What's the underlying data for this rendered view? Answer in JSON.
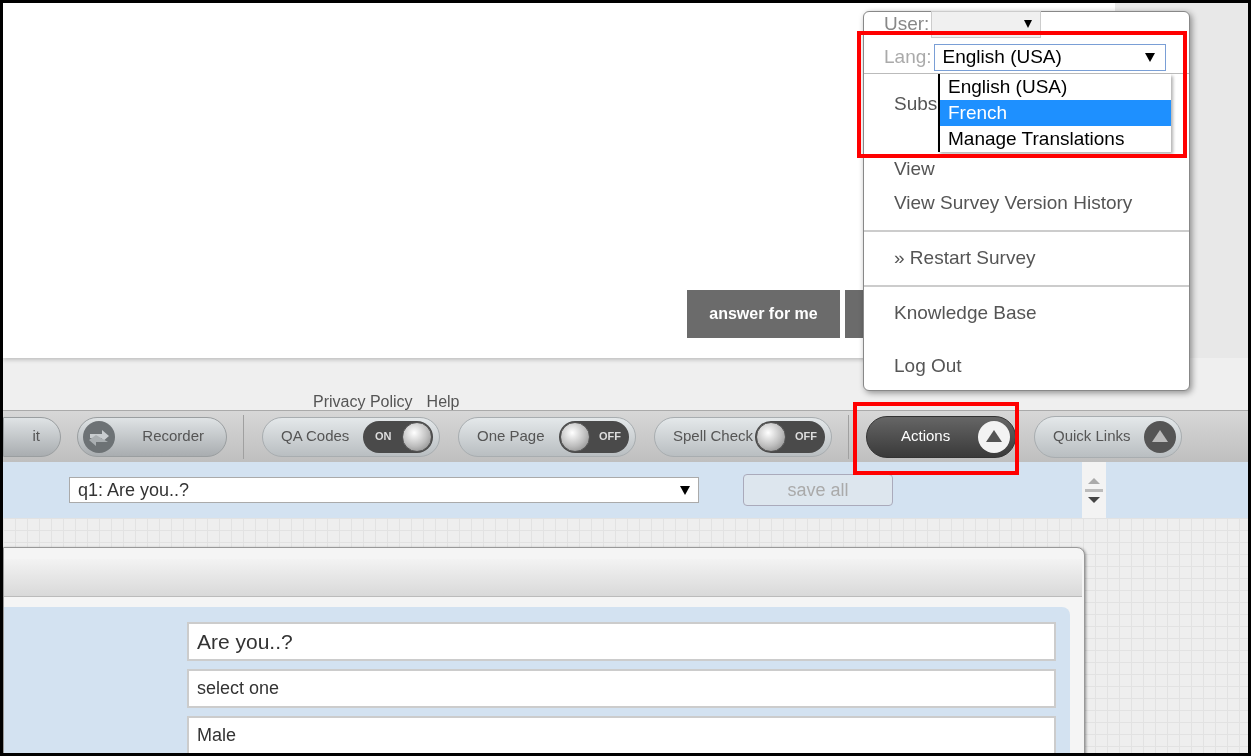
{
  "preview": {
    "buttons": [
      "answer for me"
    ]
  },
  "footer_links": [
    "Privacy Policy",
    "Help"
  ],
  "toolbar": {
    "items": [
      {
        "kind": "button",
        "label": "it"
      },
      {
        "kind": "button",
        "label": "Recorder"
      },
      {
        "kind": "toggle",
        "label": "QA Codes",
        "state": "ON",
        "on": true
      },
      {
        "kind": "toggle",
        "label": "One Page",
        "state": "OFF",
        "on": false
      },
      {
        "kind": "toggle",
        "label": "Spell Check",
        "state": "OFF",
        "on": false
      },
      {
        "kind": "menu",
        "label": "Actions",
        "expanded": true
      },
      {
        "kind": "menu",
        "label": "Quick Links",
        "expanded": false
      }
    ]
  },
  "question_bar": {
    "question_select": "q1: Are you..?",
    "save_button": {
      "label": "save all",
      "disabled": true
    }
  },
  "editor": {
    "fields": [
      "Are you..?",
      "select one",
      "Male"
    ]
  },
  "actions_menu": {
    "user_label": "User:",
    "lang_label": "Lang:",
    "lang_value": "English (USA)",
    "lang_options": [
      {
        "label": "English (USA)",
        "selected": false
      },
      {
        "label": "French",
        "selected": true
      },
      {
        "label": "Manage Translations",
        "selected": false
      }
    ],
    "items": [
      {
        "label": "Subs",
        "divider_after": false
      },
      {
        "label": "View",
        "divider_after": false
      },
      {
        "label": "View Survey Version History",
        "divider_after": true
      },
      {
        "label": "» Restart Survey",
        "divider_after": true
      },
      {
        "label": "Knowledge Base",
        "divider_after": false
      },
      {
        "label": "Log Out",
        "divider_after": false
      }
    ]
  }
}
